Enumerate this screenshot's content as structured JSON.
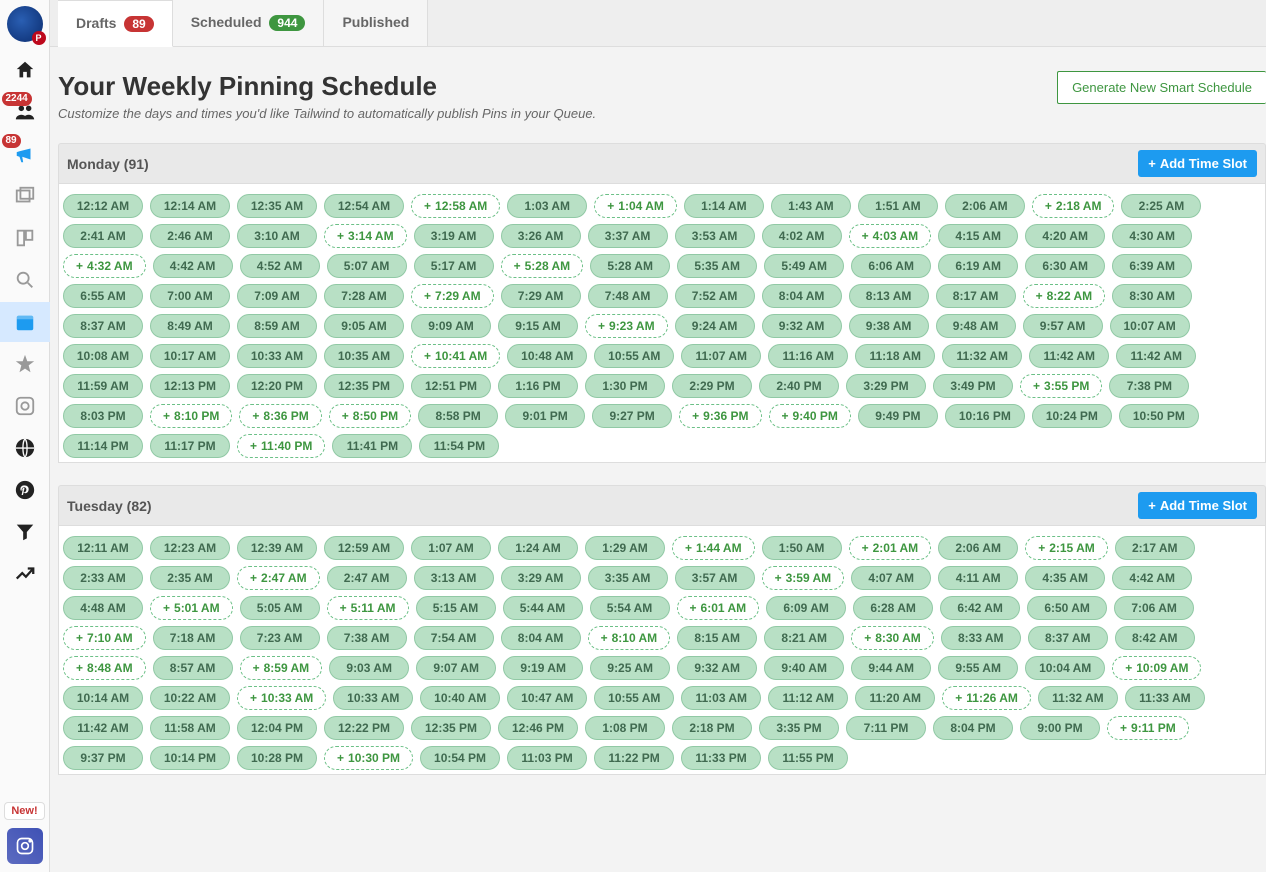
{
  "sidebar": {
    "followers_badge": "2244",
    "megaphone_badge": "89",
    "new_label": "New!"
  },
  "tabs": {
    "drafts": {
      "label": "Drafts",
      "count": "89"
    },
    "scheduled": {
      "label": "Scheduled",
      "count": "944"
    },
    "published": {
      "label": "Published"
    }
  },
  "page": {
    "heading": "Your Weekly Pinning Schedule",
    "subheading": "Customize the days and times you'd like Tailwind to automatically publish Pins in your Queue.",
    "generate_button": "Generate New Smart Schedule",
    "add_slot_label": "Add Time Slot"
  },
  "days": [
    {
      "name": "Monday",
      "count": 91,
      "slots": [
        {
          "t": "12:12 AM",
          "s": 0
        },
        {
          "t": "12:14 AM",
          "s": 0
        },
        {
          "t": "12:35 AM",
          "s": 0
        },
        {
          "t": "12:54 AM",
          "s": 0
        },
        {
          "t": "12:58 AM",
          "s": 1
        },
        {
          "t": "1:03 AM",
          "s": 0
        },
        {
          "t": "1:04 AM",
          "s": 1
        },
        {
          "t": "1:14 AM",
          "s": 0
        },
        {
          "t": "1:43 AM",
          "s": 0
        },
        {
          "t": "1:51 AM",
          "s": 0
        },
        {
          "t": "2:06 AM",
          "s": 0
        },
        {
          "t": "2:18 AM",
          "s": 1
        },
        {
          "t": "2:25 AM",
          "s": 0
        },
        {
          "t": "2:41 AM",
          "s": 0
        },
        {
          "t": "2:46 AM",
          "s": 0
        },
        {
          "t": "3:10 AM",
          "s": 0
        },
        {
          "t": "3:14 AM",
          "s": 1
        },
        {
          "t": "3:19 AM",
          "s": 0
        },
        {
          "t": "3:26 AM",
          "s": 0
        },
        {
          "t": "3:37 AM",
          "s": 0
        },
        {
          "t": "3:53 AM",
          "s": 0
        },
        {
          "t": "4:02 AM",
          "s": 0
        },
        {
          "t": "4:03 AM",
          "s": 1
        },
        {
          "t": "4:15 AM",
          "s": 0
        },
        {
          "t": "4:20 AM",
          "s": 0
        },
        {
          "t": "4:30 AM",
          "s": 0
        },
        {
          "t": "4:32 AM",
          "s": 1
        },
        {
          "t": "4:42 AM",
          "s": 0
        },
        {
          "t": "4:52 AM",
          "s": 0
        },
        {
          "t": "5:07 AM",
          "s": 0
        },
        {
          "t": "5:17 AM",
          "s": 0
        },
        {
          "t": "5:28 AM",
          "s": 1
        },
        {
          "t": "5:28 AM",
          "s": 0
        },
        {
          "t": "5:35 AM",
          "s": 0
        },
        {
          "t": "5:49 AM",
          "s": 0
        },
        {
          "t": "6:06 AM",
          "s": 0
        },
        {
          "t": "6:19 AM",
          "s": 0
        },
        {
          "t": "6:30 AM",
          "s": 0
        },
        {
          "t": "6:39 AM",
          "s": 0
        },
        {
          "t": "6:55 AM",
          "s": 0
        },
        {
          "t": "7:00 AM",
          "s": 0
        },
        {
          "t": "7:09 AM",
          "s": 0
        },
        {
          "t": "7:28 AM",
          "s": 0
        },
        {
          "t": "7:29 AM",
          "s": 1
        },
        {
          "t": "7:29 AM",
          "s": 0
        },
        {
          "t": "7:48 AM",
          "s": 0
        },
        {
          "t": "7:52 AM",
          "s": 0
        },
        {
          "t": "8:04 AM",
          "s": 0
        },
        {
          "t": "8:13 AM",
          "s": 0
        },
        {
          "t": "8:17 AM",
          "s": 0
        },
        {
          "t": "8:22 AM",
          "s": 1
        },
        {
          "t": "8:30 AM",
          "s": 0
        },
        {
          "t": "8:37 AM",
          "s": 0
        },
        {
          "t": "8:49 AM",
          "s": 0
        },
        {
          "t": "8:59 AM",
          "s": 0
        },
        {
          "t": "9:05 AM",
          "s": 0
        },
        {
          "t": "9:09 AM",
          "s": 0
        },
        {
          "t": "9:15 AM",
          "s": 0
        },
        {
          "t": "9:23 AM",
          "s": 1
        },
        {
          "t": "9:24 AM",
          "s": 0
        },
        {
          "t": "9:32 AM",
          "s": 0
        },
        {
          "t": "9:38 AM",
          "s": 0
        },
        {
          "t": "9:48 AM",
          "s": 0
        },
        {
          "t": "9:57 AM",
          "s": 0
        },
        {
          "t": "10:07 AM",
          "s": 0
        },
        {
          "t": "10:08 AM",
          "s": 0
        },
        {
          "t": "10:17 AM",
          "s": 0
        },
        {
          "t": "10:33 AM",
          "s": 0
        },
        {
          "t": "10:35 AM",
          "s": 0
        },
        {
          "t": "10:41 AM",
          "s": 1
        },
        {
          "t": "10:48 AM",
          "s": 0
        },
        {
          "t": "10:55 AM",
          "s": 0
        },
        {
          "t": "11:07 AM",
          "s": 0
        },
        {
          "t": "11:16 AM",
          "s": 0
        },
        {
          "t": "11:18 AM",
          "s": 0
        },
        {
          "t": "11:32 AM",
          "s": 0
        },
        {
          "t": "11:42 AM",
          "s": 0
        },
        {
          "t": "11:42 AM",
          "s": 0
        },
        {
          "t": "11:59 AM",
          "s": 0
        },
        {
          "t": "12:13 PM",
          "s": 0
        },
        {
          "t": "12:20 PM",
          "s": 0
        },
        {
          "t": "12:35 PM",
          "s": 0
        },
        {
          "t": "12:51 PM",
          "s": 0
        },
        {
          "t": "1:16 PM",
          "s": 0
        },
        {
          "t": "1:30 PM",
          "s": 0
        },
        {
          "t": "2:29 PM",
          "s": 0
        },
        {
          "t": "2:40 PM",
          "s": 0
        },
        {
          "t": "3:29 PM",
          "s": 0
        },
        {
          "t": "3:49 PM",
          "s": 0
        },
        {
          "t": "3:55 PM",
          "s": 1
        },
        {
          "t": "7:38 PM",
          "s": 0
        },
        {
          "t": "8:03 PM",
          "s": 0
        },
        {
          "t": "8:10 PM",
          "s": 1
        },
        {
          "t": "8:36 PM",
          "s": 1
        },
        {
          "t": "8:50 PM",
          "s": 1
        },
        {
          "t": "8:58 PM",
          "s": 0
        },
        {
          "t": "9:01 PM",
          "s": 0
        },
        {
          "t": "9:27 PM",
          "s": 0
        },
        {
          "t": "9:36 PM",
          "s": 1
        },
        {
          "t": "9:40 PM",
          "s": 1
        },
        {
          "t": "9:49 PM",
          "s": 0
        },
        {
          "t": "10:16 PM",
          "s": 0
        },
        {
          "t": "10:24 PM",
          "s": 0
        },
        {
          "t": "10:50 PM",
          "s": 0
        },
        {
          "t": "11:14 PM",
          "s": 0
        },
        {
          "t": "11:17 PM",
          "s": 0
        },
        {
          "t": "11:40 PM",
          "s": 1
        },
        {
          "t": "11:41 PM",
          "s": 0
        },
        {
          "t": "11:54 PM",
          "s": 0
        }
      ]
    },
    {
      "name": "Tuesday",
      "count": 82,
      "slots": [
        {
          "t": "12:11 AM",
          "s": 0
        },
        {
          "t": "12:23 AM",
          "s": 0
        },
        {
          "t": "12:39 AM",
          "s": 0
        },
        {
          "t": "12:59 AM",
          "s": 0
        },
        {
          "t": "1:07 AM",
          "s": 0
        },
        {
          "t": "1:24 AM",
          "s": 0
        },
        {
          "t": "1:29 AM",
          "s": 0
        },
        {
          "t": "1:44 AM",
          "s": 1
        },
        {
          "t": "1:50 AM",
          "s": 0
        },
        {
          "t": "2:01 AM",
          "s": 1
        },
        {
          "t": "2:06 AM",
          "s": 0
        },
        {
          "t": "2:15 AM",
          "s": 1
        },
        {
          "t": "2:17 AM",
          "s": 0
        },
        {
          "t": "2:33 AM",
          "s": 0
        },
        {
          "t": "2:35 AM",
          "s": 0
        },
        {
          "t": "2:47 AM",
          "s": 1
        },
        {
          "t": "2:47 AM",
          "s": 0
        },
        {
          "t": "3:13 AM",
          "s": 0
        },
        {
          "t": "3:29 AM",
          "s": 0
        },
        {
          "t": "3:35 AM",
          "s": 0
        },
        {
          "t": "3:57 AM",
          "s": 0
        },
        {
          "t": "3:59 AM",
          "s": 1
        },
        {
          "t": "4:07 AM",
          "s": 0
        },
        {
          "t": "4:11 AM",
          "s": 0
        },
        {
          "t": "4:35 AM",
          "s": 0
        },
        {
          "t": "4:42 AM",
          "s": 0
        },
        {
          "t": "4:48 AM",
          "s": 0
        },
        {
          "t": "5:01 AM",
          "s": 1
        },
        {
          "t": "5:05 AM",
          "s": 0
        },
        {
          "t": "5:11 AM",
          "s": 1
        },
        {
          "t": "5:15 AM",
          "s": 0
        },
        {
          "t": "5:44 AM",
          "s": 0
        },
        {
          "t": "5:54 AM",
          "s": 0
        },
        {
          "t": "6:01 AM",
          "s": 1
        },
        {
          "t": "6:09 AM",
          "s": 0
        },
        {
          "t": "6:28 AM",
          "s": 0
        },
        {
          "t": "6:42 AM",
          "s": 0
        },
        {
          "t": "6:50 AM",
          "s": 0
        },
        {
          "t": "7:06 AM",
          "s": 0
        },
        {
          "t": "7:10 AM",
          "s": 1
        },
        {
          "t": "7:18 AM",
          "s": 0
        },
        {
          "t": "7:23 AM",
          "s": 0
        },
        {
          "t": "7:38 AM",
          "s": 0
        },
        {
          "t": "7:54 AM",
          "s": 0
        },
        {
          "t": "8:04 AM",
          "s": 0
        },
        {
          "t": "8:10 AM",
          "s": 1
        },
        {
          "t": "8:15 AM",
          "s": 0
        },
        {
          "t": "8:21 AM",
          "s": 0
        },
        {
          "t": "8:30 AM",
          "s": 1
        },
        {
          "t": "8:33 AM",
          "s": 0
        },
        {
          "t": "8:37 AM",
          "s": 0
        },
        {
          "t": "8:42 AM",
          "s": 0
        },
        {
          "t": "8:48 AM",
          "s": 1
        },
        {
          "t": "8:57 AM",
          "s": 0
        },
        {
          "t": "8:59 AM",
          "s": 1
        },
        {
          "t": "9:03 AM",
          "s": 0
        },
        {
          "t": "9:07 AM",
          "s": 0
        },
        {
          "t": "9:19 AM",
          "s": 0
        },
        {
          "t": "9:25 AM",
          "s": 0
        },
        {
          "t": "9:32 AM",
          "s": 0
        },
        {
          "t": "9:40 AM",
          "s": 0
        },
        {
          "t": "9:44 AM",
          "s": 0
        },
        {
          "t": "9:55 AM",
          "s": 0
        },
        {
          "t": "10:04 AM",
          "s": 0
        },
        {
          "t": "10:09 AM",
          "s": 1
        },
        {
          "t": "10:14 AM",
          "s": 0
        },
        {
          "t": "10:22 AM",
          "s": 0
        },
        {
          "t": "10:33 AM",
          "s": 1
        },
        {
          "t": "10:33 AM",
          "s": 0
        },
        {
          "t": "10:40 AM",
          "s": 0
        },
        {
          "t": "10:47 AM",
          "s": 0
        },
        {
          "t": "10:55 AM",
          "s": 0
        },
        {
          "t": "11:03 AM",
          "s": 0
        },
        {
          "t": "11:12 AM",
          "s": 0
        },
        {
          "t": "11:20 AM",
          "s": 0
        },
        {
          "t": "11:26 AM",
          "s": 1
        },
        {
          "t": "11:32 AM",
          "s": 0
        },
        {
          "t": "11:33 AM",
          "s": 0
        },
        {
          "t": "11:42 AM",
          "s": 0
        },
        {
          "t": "11:58 AM",
          "s": 0
        },
        {
          "t": "12:04 PM",
          "s": 0
        },
        {
          "t": "12:22 PM",
          "s": 0
        },
        {
          "t": "12:35 PM",
          "s": 0
        },
        {
          "t": "12:46 PM",
          "s": 0
        },
        {
          "t": "1:08 PM",
          "s": 0
        },
        {
          "t": "2:18 PM",
          "s": 0
        },
        {
          "t": "3:35 PM",
          "s": 0
        },
        {
          "t": "7:11 PM",
          "s": 0
        },
        {
          "t": "8:04 PM",
          "s": 0
        },
        {
          "t": "9:00 PM",
          "s": 0
        },
        {
          "t": "9:11 PM",
          "s": 1
        },
        {
          "t": "9:37 PM",
          "s": 0
        },
        {
          "t": "10:14 PM",
          "s": 0
        },
        {
          "t": "10:28 PM",
          "s": 0
        },
        {
          "t": "10:30 PM",
          "s": 1
        },
        {
          "t": "10:54 PM",
          "s": 0
        },
        {
          "t": "11:03 PM",
          "s": 0
        },
        {
          "t": "11:22 PM",
          "s": 0
        },
        {
          "t": "11:33 PM",
          "s": 0
        },
        {
          "t": "11:55 PM",
          "s": 0
        }
      ]
    }
  ]
}
